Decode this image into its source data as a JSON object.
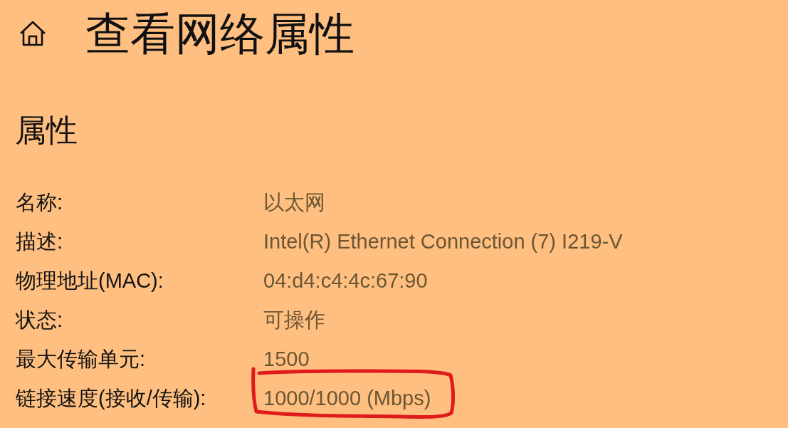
{
  "page": {
    "title": "查看网络属性"
  },
  "section": {
    "title": "属性"
  },
  "properties": [
    {
      "label": "名称:",
      "value": "以太网",
      "circled": false
    },
    {
      "label": "描述:",
      "value": "Intel(R) Ethernet Connection (7) I219-V",
      "circled": false
    },
    {
      "label": "物理地址(MAC):",
      "value": "04:d4:c4:4c:67:90",
      "circled": false
    },
    {
      "label": "状态:",
      "value": "可操作",
      "circled": false
    },
    {
      "label": "最大传输单元:",
      "value": "1500",
      "circled": false
    },
    {
      "label": "链接速度(接收/传输):",
      "value": "1000/1000 (Mbps)",
      "circled": true
    }
  ]
}
